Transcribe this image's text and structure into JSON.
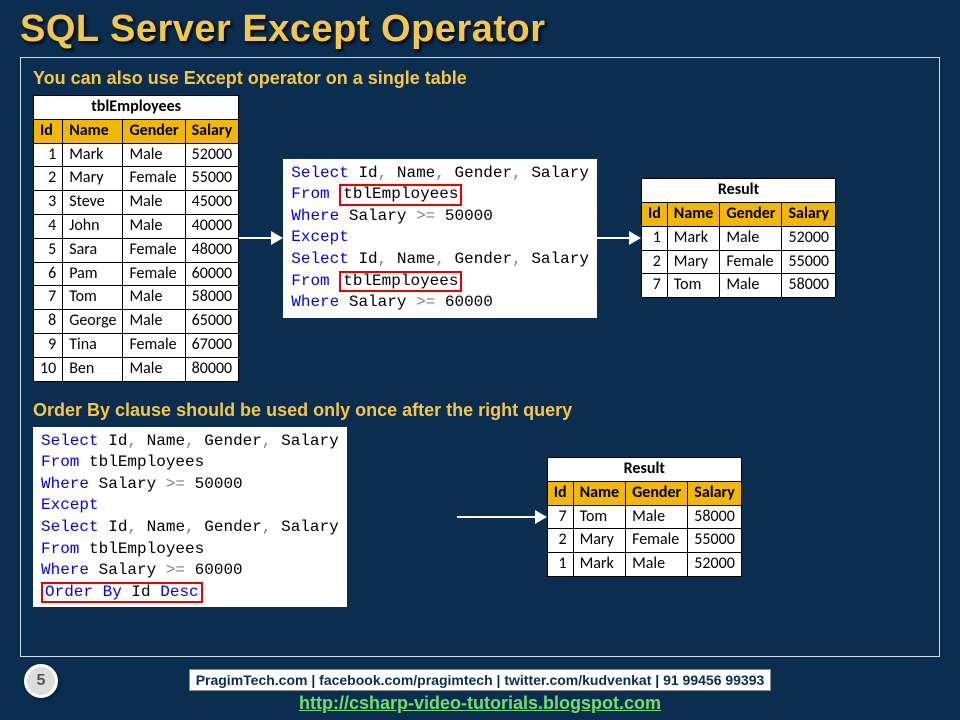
{
  "title": "SQL Server Except Operator",
  "note1": "You can also use Except operator on a single table",
  "note2": "Order By clause should be used only once after the right query",
  "tblEmployees": {
    "title": "tblEmployees",
    "headers": [
      "Id",
      "Name",
      "Gender",
      "Salary"
    ],
    "rows": [
      [
        "1",
        "Mark",
        "Male",
        "52000"
      ],
      [
        "2",
        "Mary",
        "Female",
        "55000"
      ],
      [
        "3",
        "Steve",
        "Male",
        "45000"
      ],
      [
        "4",
        "John",
        "Male",
        "40000"
      ],
      [
        "5",
        "Sara",
        "Female",
        "48000"
      ],
      [
        "6",
        "Pam",
        "Female",
        "60000"
      ],
      [
        "7",
        "Tom",
        "Male",
        "58000"
      ],
      [
        "8",
        "George",
        "Male",
        "65000"
      ],
      [
        "9",
        "Tina",
        "Female",
        "67000"
      ],
      [
        "10",
        "Ben",
        "Male",
        "80000"
      ]
    ]
  },
  "result1": {
    "title": "Result",
    "headers": [
      "Id",
      "Name",
      "Gender",
      "Salary"
    ],
    "rows": [
      [
        "1",
        "Mark",
        "Male",
        "52000"
      ],
      [
        "2",
        "Mary",
        "Female",
        "55000"
      ],
      [
        "7",
        "Tom",
        "Male",
        "58000"
      ]
    ]
  },
  "result2": {
    "title": "Result",
    "headers": [
      "Id",
      "Name",
      "Gender",
      "Salary"
    ],
    "rows": [
      [
        "7",
        "Tom",
        "Male",
        "58000"
      ],
      [
        "2",
        "Mary",
        "Female",
        "55000"
      ],
      [
        "1",
        "Mark",
        "Male",
        "52000"
      ]
    ]
  },
  "sql1": {
    "l1a": "Select",
    "l1b": " Id",
    "l1c": ",",
    "l1d": " Name",
    "l1e": ",",
    "l1f": " Gender",
    "l1g": ",",
    "l1h": " Salary",
    "l2a": "From ",
    "l2b": "tblEmployees",
    "l3a": "Where",
    "l3b": " Salary ",
    "l3c": ">=",
    "l3d": " 50000",
    "l4": "Except",
    "l7a": "Where",
    "l7b": " Salary ",
    "l7c": ">=",
    "l7d": " 60000"
  },
  "sql2": {
    "l1a": "Select",
    "l1b": " Id",
    "l1c": ",",
    "l1d": " Name",
    "l1e": ",",
    "l1f": " Gender",
    "l1g": ",",
    "l1h": " Salary",
    "l2a": "From",
    "l2b": " tblEmployees",
    "l3a": "Where",
    "l3b": " Salary ",
    "l3c": ">=",
    "l3d": " 50000",
    "l4": "Except",
    "l7a": "Where",
    "l7b": " Salary ",
    "l7c": ">=",
    "l7d": " 60000",
    "l8a": "Order",
    "l8b": " ",
    "l8c": "By",
    "l8d": " Id ",
    "l8e": "Desc"
  },
  "footer": {
    "badge": "PragimTech.com | facebook.com/pragimtech | twitter.com/kudvenkat | 91 99456 99393",
    "link": "http://csharp-video-tutorials.blogspot.com"
  },
  "page": "5"
}
